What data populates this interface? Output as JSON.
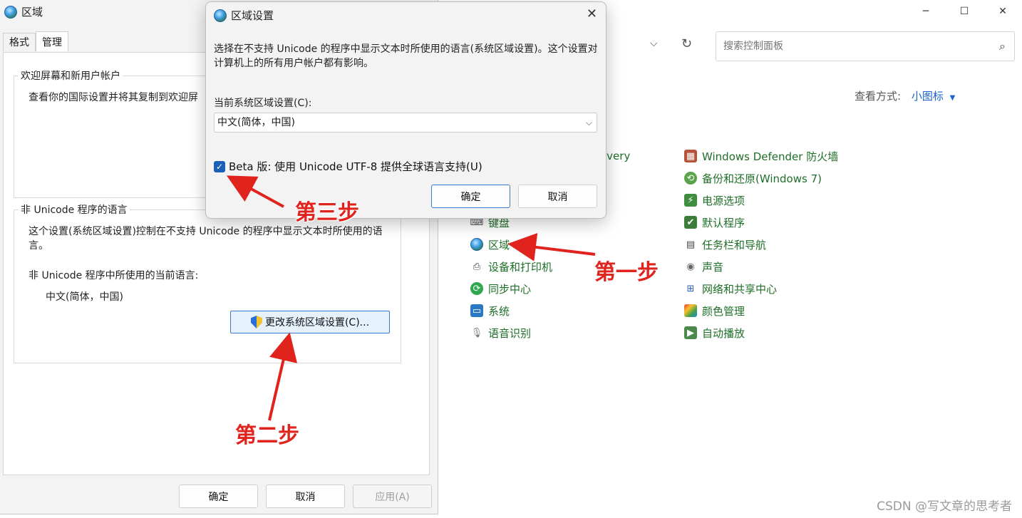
{
  "control_panel": {
    "search_placeholder": "搜索控制面板",
    "view_by_label": "查看方式:",
    "view_by_value": "小图标",
    "recovery_fragment": "overy",
    "items_left": [
      {
        "label": "键盘",
        "icon": "keyboard-icon"
      },
      {
        "label": "区域",
        "icon": "globe-icon"
      },
      {
        "label": "设备和打印机",
        "icon": "printer-icon"
      },
      {
        "label": "同步中心",
        "icon": "sync-icon"
      },
      {
        "label": "系统",
        "icon": "computer-icon"
      },
      {
        "label": "语音识别",
        "icon": "microphone-icon"
      }
    ],
    "items_right": [
      {
        "label": "Windows Defender 防火墙",
        "icon": "firewall-icon"
      },
      {
        "label": "备份和还原(Windows 7)",
        "icon": "backup-icon"
      },
      {
        "label": "电源选项",
        "icon": "power-icon"
      },
      {
        "label": "默认程序",
        "icon": "default-programs-icon"
      },
      {
        "label": "任务栏和导航",
        "icon": "taskbar-icon"
      },
      {
        "label": "声音",
        "icon": "speaker-icon"
      },
      {
        "label": "网络和共享中心",
        "icon": "network-icon"
      },
      {
        "label": "颜色管理",
        "icon": "color-management-icon"
      },
      {
        "label": "自动播放",
        "icon": "autoplay-icon"
      }
    ]
  },
  "region_dialog": {
    "title": "区域",
    "tabs": [
      "格式",
      "管理"
    ],
    "welcome_group_title": "欢迎屏幕和新用户帐户",
    "welcome_text": "查看你的国际设置并将其复制到欢迎屏",
    "nonunicode_group_title": "非 Unicode 程序的语言",
    "nonunicode_desc": "这个设置(系统区域设置)控制在不支持 Unicode 的程序中显示文本时所使用的语言。",
    "current_lang_label": "非 Unicode 程序中所使用的当前语言:",
    "current_lang_value": "中文(简体，中国)",
    "change_button": "更改系统区域设置(C)...",
    "ok": "确定",
    "cancel": "取消",
    "apply": "应用(A)"
  },
  "locale_dialog": {
    "title": "区域设置",
    "description": "选择在不支持 Unicode 的程序中显示文本时所使用的语言(系统区域设置)。这个设置对计算机上的所有用户帐户都有影响。",
    "current_label": "当前系统区域设置(C):",
    "current_value": "中文(简体，中国)",
    "beta_label": "Beta 版: 使用 Unicode UTF-8 提供全球语言支持(U)",
    "beta_checked": true,
    "ok": "确定",
    "cancel": "取消"
  },
  "annotations": {
    "step1": "第一步",
    "step2": "第二步",
    "step3": "第三步",
    "arrow_color": "#e0231c"
  },
  "watermark": "CSDN @写文章的思考者"
}
